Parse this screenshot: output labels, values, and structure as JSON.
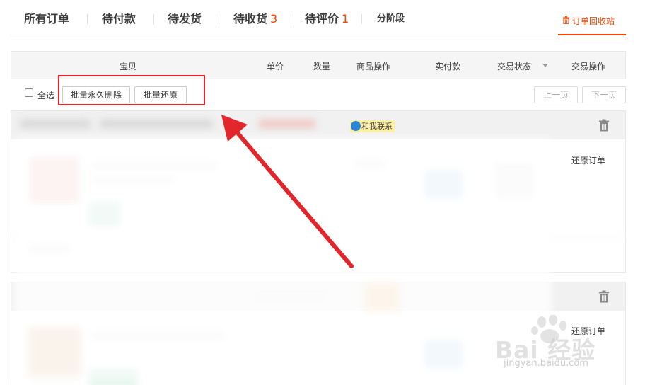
{
  "tabs": [
    {
      "label": "所有订单",
      "count": ""
    },
    {
      "label": "待付款",
      "count": ""
    },
    {
      "label": "待发货",
      "count": ""
    },
    {
      "label": "待收货",
      "count": "3"
    },
    {
      "label": "待评价",
      "count": "1"
    },
    {
      "label": "分阶段",
      "count": ""
    }
  ],
  "recycle_bin": {
    "label": "订单回收站",
    "icon": "trash-icon"
  },
  "table_header": {
    "item": "宝贝",
    "price": "单价",
    "quantity": "数量",
    "item_ops": "商品操作",
    "paid": "实付款",
    "status": "交易状态",
    "trade_ops": "交易操作"
  },
  "batch": {
    "select_all": "全选",
    "delete_forever": "批量永久删除",
    "restore_all": "批量还原"
  },
  "pager": {
    "prev": "上一页",
    "next": "下一页"
  },
  "orders": [
    {
      "contact_label": "和我联系",
      "restore_label": "还原订单"
    },
    {
      "restore_label": "还原订单"
    }
  ],
  "watermark": {
    "brand": "Bai 经验",
    "url": "jingyan.baidu.com"
  },
  "colors": {
    "accent": "#ff4400",
    "annotation_red": "#e2262b",
    "header_bg": "#f5f5f5"
  }
}
